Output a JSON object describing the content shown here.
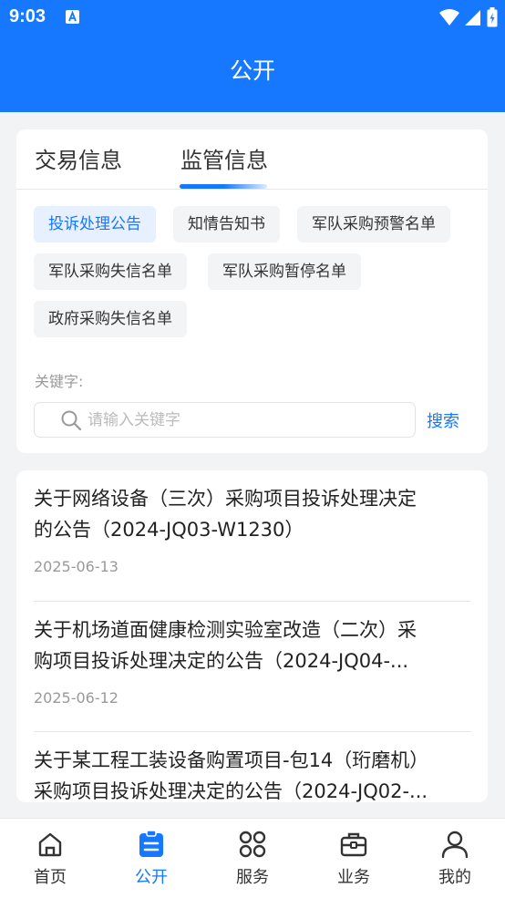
{
  "status_bar": {
    "time": "9:03"
  },
  "header": {
    "title": "公开"
  },
  "tabs": [
    {
      "label": "交易信息"
    },
    {
      "label": "监管信息"
    }
  ],
  "chips": [
    {
      "label": "投诉处理公告"
    },
    {
      "label": "知情告知书"
    },
    {
      "label": "军队采购预警名单"
    },
    {
      "label": "军队采购失信名单"
    },
    {
      "label": "军队采购暂停名单"
    },
    {
      "label": "政府采购失信名单"
    }
  ],
  "search": {
    "label": "关键字:",
    "placeholder": "请输入关键字",
    "button": "搜索"
  },
  "list": [
    {
      "title_line1": "关于网络设备（三次）采购项目投诉处理决定",
      "title_line2": "的公告（2024-JQ03-W1230）",
      "date": "2025-06-13"
    },
    {
      "title_line1": "关于机场道面健康检测实验室改造（二次）采",
      "title_line2": "购项目投诉处理决定的公告（2024-JQ04-...",
      "date": "2025-06-12"
    },
    {
      "title_line1": "关于某工程工装设备购置项目-包14（珩磨机）",
      "title_line2": "采购项目投诉处理决定的公告（2024-JQ02-...",
      "date": ""
    }
  ],
  "bottom_nav": [
    {
      "label": "首页",
      "icon": "home-icon"
    },
    {
      "label": "公开",
      "icon": "clipboard-icon"
    },
    {
      "label": "服务",
      "icon": "grid-icon"
    },
    {
      "label": "业务",
      "icon": "briefcase-icon"
    },
    {
      "label": "我的",
      "icon": "user-icon"
    }
  ],
  "colors": {
    "accent": "#1677ff",
    "background": "#f2f3f5",
    "chip_bg": "#f3f4f6",
    "chip_active_bg": "#e6f0ff"
  }
}
